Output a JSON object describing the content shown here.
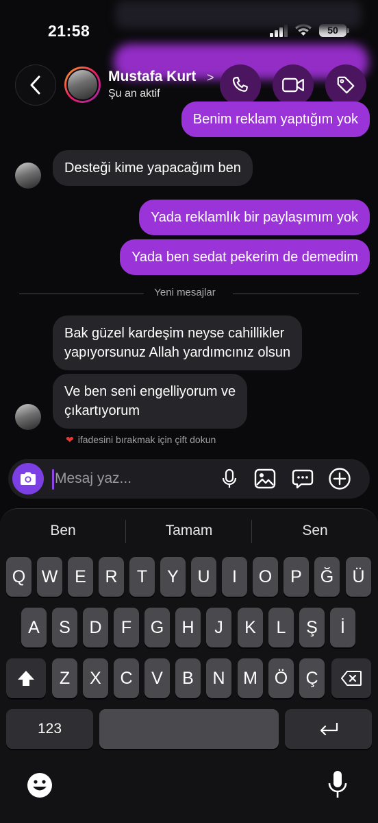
{
  "status_bar": {
    "time": "21:58",
    "battery": "50"
  },
  "header": {
    "name": "Mustafa Kurt",
    "chevron": ">",
    "status": "Şu an aktif"
  },
  "messages": [
    {
      "direction": "out",
      "text": "Benim reklam yaptığım yok"
    },
    {
      "direction": "in",
      "text": "Desteği kime yapacağım ben"
    },
    {
      "direction": "out",
      "text": "Yada reklamlık bir paylaşımım yok"
    },
    {
      "direction": "out",
      "text": "Yada ben sedat pekerim de demedim"
    },
    {
      "direction": "in",
      "lines": [
        "Bak güzel kardeşim neyse cahillikler",
        "yapıyorsunuz Allah yardımcınız olsun"
      ]
    },
    {
      "direction": "in",
      "lines": [
        "Ve ben seni engelliyorum ve",
        "çıkartıyorum"
      ]
    }
  ],
  "divider_label": "Yeni mesajlar",
  "reaction_hint": {
    "icon": "heart-icon",
    "text": "ifadesini bırakmak için çift dokun"
  },
  "composer": {
    "placeholder": "Mesaj yaz..."
  },
  "keyboard": {
    "suggestions": [
      "Ben",
      "Tamam",
      "Sen"
    ],
    "row1": [
      "Q",
      "W",
      "E",
      "R",
      "T",
      "Y",
      "U",
      "I",
      "O",
      "P",
      "Ğ",
      "Ü"
    ],
    "row2": [
      "A",
      "S",
      "D",
      "F",
      "G",
      "H",
      "J",
      "K",
      "L",
      "Ş",
      "İ"
    ],
    "row3": [
      "Z",
      "X",
      "C",
      "V",
      "B",
      "N",
      "M",
      "Ö",
      "Ç"
    ],
    "numbers_key": "123"
  },
  "colors": {
    "outgoing_bubble": "#9b34d8",
    "incoming_bubble": "#26262a",
    "accent": "#7b3fe4",
    "header_buttons": "#4b1560"
  }
}
